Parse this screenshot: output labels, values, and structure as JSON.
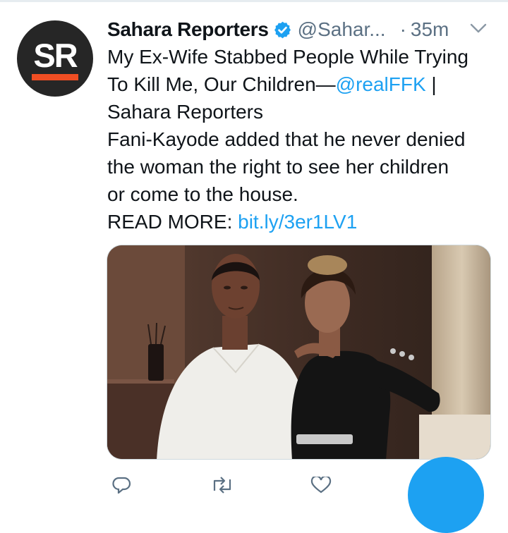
{
  "tweet": {
    "avatar": {
      "initials": "SR",
      "accent_color": "#f04e23",
      "bg_color": "#262626"
    },
    "author_name": "Sahara Reporters",
    "verified_icon": "verified-badge-icon",
    "handle": "@Sahar...",
    "dot": "·",
    "time": "35m",
    "menu_icon": "chevron-down-icon",
    "headline_line1": "My Ex-Wife Stabbed People While Trying",
    "headline_line2_text": "To Kill Me, Our Children—",
    "mention": "@realFFK",
    "headline_line2_suffix": " |",
    "headline_line3": "Sahara Reporters",
    "summary_line1": "Fani-Kayode added that he never denied",
    "summary_line2": "the woman the right to see her children",
    "summary_line3": "or come to the house.",
    "read_more_label": "READ MORE: ",
    "read_more_link": "bit.ly/3er1LV1",
    "media": {
      "description_icon": "photo-of-man-and-woman"
    },
    "actions": [
      {
        "icon": "reply-icon",
        "count": ""
      },
      {
        "icon": "retweet-icon",
        "count": ""
      },
      {
        "icon": "like-icon",
        "count": ""
      }
    ],
    "accent_color": "#1da1f2"
  },
  "compose_button": {
    "icon": "compose-icon"
  }
}
